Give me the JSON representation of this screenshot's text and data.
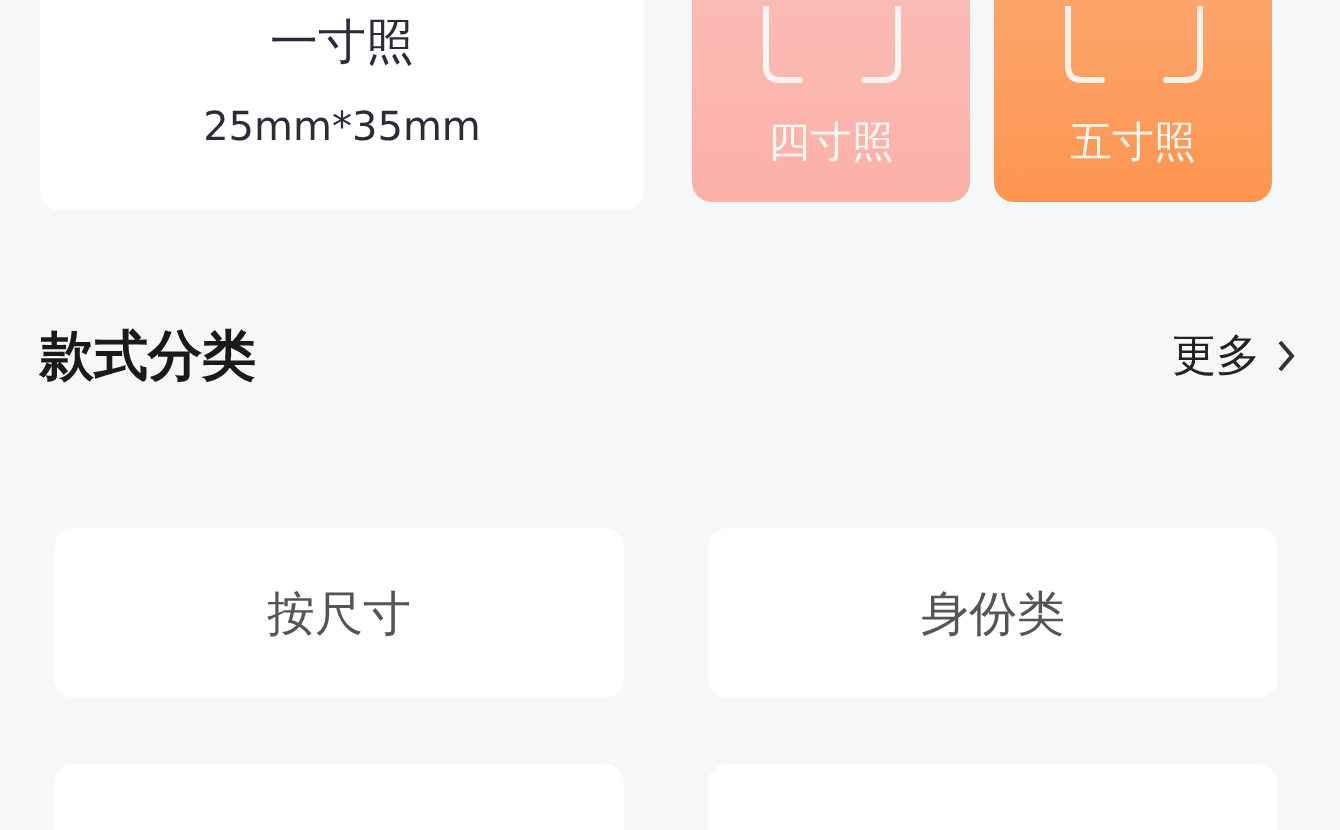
{
  "photo_sizes": [
    {
      "kind": "card",
      "title": "一寸照",
      "subtitle": "25mm*35mm"
    },
    {
      "kind": "tile",
      "label": "四寸照",
      "color": "#fbb0a8"
    },
    {
      "kind": "tile",
      "label": "五寸照",
      "color": "#fd9550"
    }
  ],
  "section": {
    "title": "款式分类",
    "more": "更多"
  },
  "categories": [
    {
      "kind": "labeled",
      "label": "按尺寸"
    },
    {
      "kind": "labeled",
      "label": "身份类"
    },
    {
      "kind": "blank"
    },
    {
      "kind": "blank"
    }
  ]
}
